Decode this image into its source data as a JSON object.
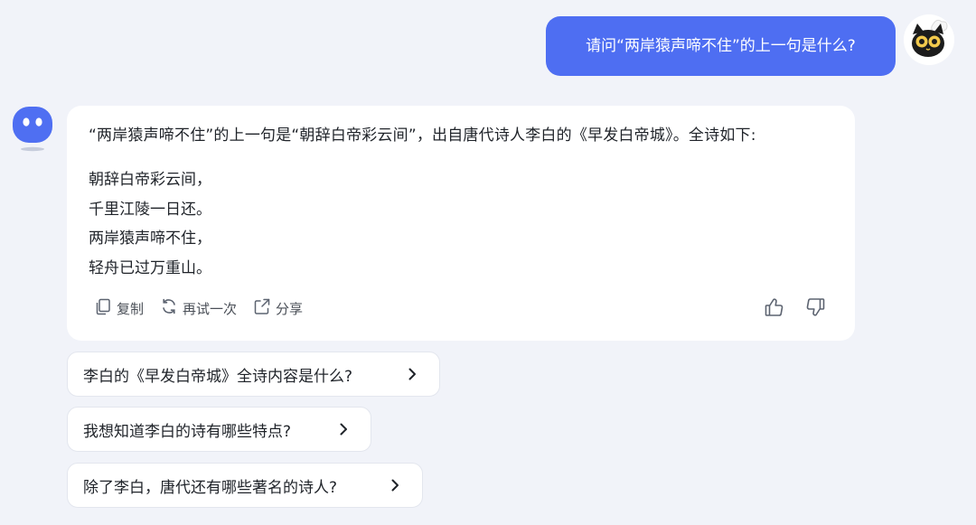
{
  "user_message": {
    "text": "请问“两岸猿声啼不住”的上一句是什么?"
  },
  "answer": {
    "intro": "“两岸猿声啼不住”的上一句是“朝辞白帝彩云间”，出自唐代诗人李白的《早发白帝城》。全诗如下:",
    "poem_lines": [
      "朝辞白帝彩云间，",
      "千里江陵一日还。",
      "两岸猿声啼不住，",
      "轻舟已过万重山。"
    ],
    "actions": {
      "copy_label": "复制",
      "retry_label": "再试一次",
      "share_label": "分享"
    }
  },
  "suggestions": [
    {
      "text": "李白的《早发白帝城》全诗内容是什么?"
    },
    {
      "text": "我想知道李白的诗有哪些特点?"
    },
    {
      "text": "除了李白，唐代还有哪些著名的诗人?"
    }
  ],
  "icons": {
    "copy": "copy-icon",
    "retry": "refresh-icon",
    "share": "share-icon",
    "like": "thumbs-up-icon",
    "dislike": "thumbs-down-icon",
    "suggestion_arrow": "chevron-right-icon"
  },
  "colors": {
    "user_bubble": "#4e6ef2",
    "background": "#f1f3f9",
    "bot_avatar": "#4f6ff2",
    "card": "#ffffff"
  }
}
